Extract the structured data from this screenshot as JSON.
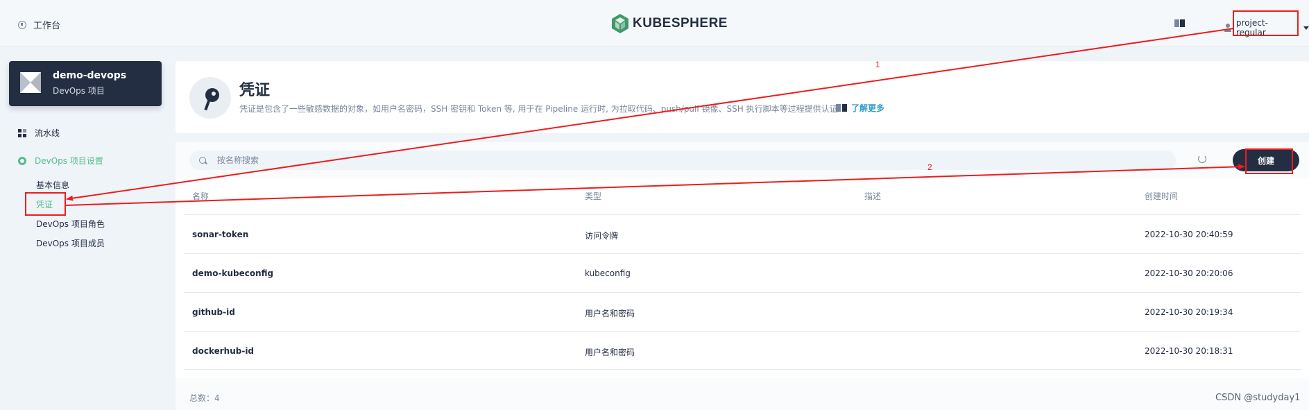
{
  "header": {
    "workbench_label": "工作台",
    "logo_text": "KUBESPHERE",
    "user_name": "project-regular",
    "brand_color": "#55bc8a"
  },
  "sidebar": {
    "project_name": "demo-devops",
    "project_type": "DevOps 项目",
    "items": [
      {
        "label": "流水线",
        "icon": "grid-icon"
      },
      {
        "label": "DevOps 项目设置",
        "icon": "gear-icon"
      }
    ],
    "sub_items": [
      {
        "label": "基本信息"
      },
      {
        "label": "凭证",
        "active": true
      },
      {
        "label": "DevOps 项目角色"
      },
      {
        "label": "DevOps 项目成员"
      }
    ]
  },
  "banner": {
    "title": "凭证",
    "description": "凭证是包含了一些敏感数据的对象，如用户名密码，SSH 密钥和 Token 等, 用于在 Pipeline 运行时, 为拉取代码、push/pull 镜像、SSH 执行脚本等过程提供认证",
    "learn_more": "了解更多"
  },
  "list": {
    "search_placeholder": "按名称搜索",
    "create_label": "创建",
    "columns": [
      "名称",
      "类型",
      "描述",
      "创建时间"
    ],
    "rows": [
      {
        "name": "sonar-token",
        "type": "访问令牌",
        "desc": "",
        "created": "2022-10-30 20:40:59"
      },
      {
        "name": "demo-kubeconfig",
        "type": "kubeconfig",
        "desc": "",
        "created": "2022-10-30 20:20:06"
      },
      {
        "name": "github-id",
        "type": "用户名和密码",
        "desc": "",
        "created": "2022-10-30 20:19:34"
      },
      {
        "name": "dockerhub-id",
        "type": "用户名和密码",
        "desc": "",
        "created": "2022-10-30 20:18:31"
      }
    ],
    "total": "总数：4"
  },
  "annotations": {
    "label_1": "1",
    "label_2": "2",
    "color": "#ee1c1c"
  },
  "watermark": "CSDN @studyday1"
}
